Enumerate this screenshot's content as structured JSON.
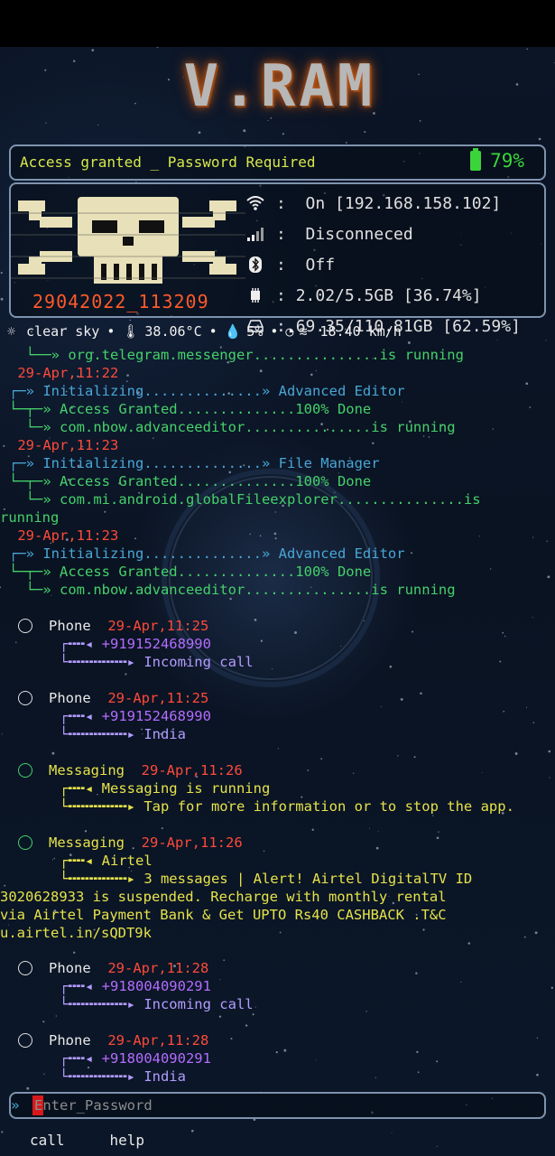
{
  "header": {
    "logo_text": "V.RAM"
  },
  "status": {
    "message": "Access granted _ Password Required",
    "battery_pct": "79%",
    "battery_color": "#3bd43b"
  },
  "device": {
    "id": "29042022_113209",
    "wifi": "On [192.168.158.102]",
    "signal": "Disconneced",
    "bluetooth": "Off",
    "ram": "2.02/5.5GB [36.74%]",
    "storage": "69.35/110.81GB [62.59%]"
  },
  "weather": {
    "condition": "clear sky",
    "temperature": "38.06°C",
    "humidity": "5%",
    "wind": "18.40 km/h"
  },
  "log": {
    "l1": "  └──» org.telegram.messenger...............is running",
    "l2": " 29-Apr,11:22",
    "l3": "┌─» Initializing..............» Advanced Editor",
    "l4": "└─┬─» Access Granted..............100% Done",
    "l5": "  └─» com.nbow.advanceeditor...............is running",
    "l6": " 29-Apr,11:23",
    "l7": "┌─» Initializing..............» File Manager",
    "l8": "└─┬─» Access Granted..............100% Done",
    "l9": "  └─» com.mi.android.globalFileexplorer...............is",
    "l10": "running",
    "l11": " 29-Apr,11:23",
    "l12": "┌─» Initializing..............» Advanced Editor",
    "l13": "└─┬─» Access Granted..............100% Done",
    "l14": "  └─» com.nbow.advanceeditor...............is running"
  },
  "notifications": [
    {
      "app": "Phone",
      "time": "29-Apr,11:25",
      "line1": "+919152468990",
      "line2": "Incoming call"
    },
    {
      "app": "Phone",
      "time": "29-Apr,11:25",
      "line1": "+919152468990",
      "line2": "India"
    },
    {
      "app": "Messaging",
      "time": "29-Apr,11:26",
      "line1": "Messaging is running",
      "line2": "Tap for more information or to stop the app."
    },
    {
      "app": "Messaging",
      "time": "29-Apr,11:26",
      "line1": "Airtel",
      "line2": "3 messages | Alert! Airtel DigitalTV ID",
      "extra1": "3020628933 is suspended. Recharge with monthly rental",
      "extra2": "via Airtel Payment Bank & Get UPTO Rs40 CASHBACK .T&C",
      "extra3": "u.airtel.in/sQDT9k"
    },
    {
      "app": "Phone",
      "time": "29-Apr,11:28",
      "line1": "+918004090291",
      "line2": "Incoming call"
    },
    {
      "app": "Phone",
      "time": "29-Apr,11:28",
      "line1": "+918004090291",
      "line2": "India"
    }
  ],
  "input": {
    "prompt": "»",
    "placeholder": "Enter_Password"
  },
  "bottom": {
    "call": "call",
    "help": "help"
  }
}
